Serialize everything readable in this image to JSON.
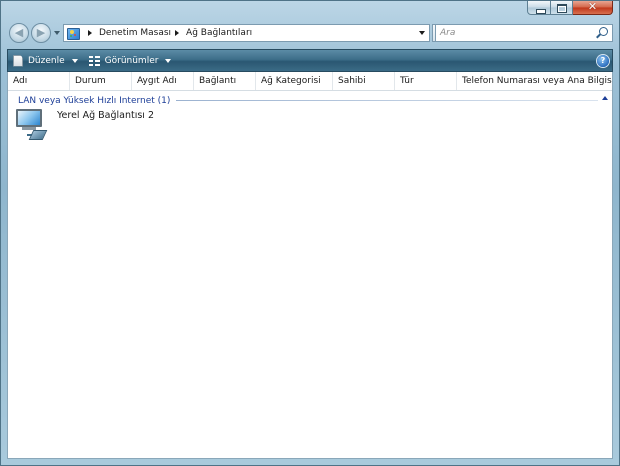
{
  "window": {
    "close_glyph": "✕"
  },
  "nav": {
    "back_glyph": "◀",
    "forward_glyph": "▶",
    "breadcrumbs": [
      "Denetim Masası",
      "Ağ Bağlantıları"
    ],
    "refresh_glyph": "↻",
    "search_placeholder": "Ara"
  },
  "toolbar": {
    "organize_label": "Düzenle",
    "views_label": "Görünümler",
    "help_glyph": "?"
  },
  "columns": [
    "Adı",
    "Durum",
    "Aygıt Adı",
    "Bağlantı",
    "Ağ Kategorisi",
    "Sahibi",
    "Tür",
    "Telefon Numarası veya Ana Bilgisa..."
  ],
  "groups": [
    {
      "label": "LAN veya Yüksek Hızlı Internet (1)",
      "items": [
        {
          "label": "Yerel Ağ Bağlantısı 2",
          "icon": "network-connection-icon"
        }
      ]
    }
  ],
  "colors": {
    "frame": "#9cc0d6",
    "toolbar": "#3d6e89",
    "group_text": "#1e3f98"
  }
}
